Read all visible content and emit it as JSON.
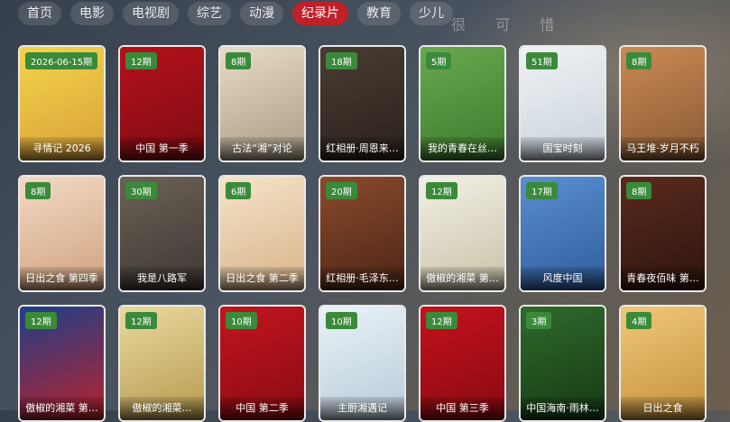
{
  "background_text": "很 可 惜",
  "tabs": [
    "首页",
    "电影",
    "电视剧",
    "综艺",
    "动漫",
    "纪录片",
    "教育",
    "少儿"
  ],
  "active_tab_index": 5,
  "accent_color": "#c0202a",
  "badge_color": "#3a8a3a",
  "cards": [
    {
      "badge": "2026-06-15期",
      "title": "寻情记 2026",
      "colors": [
        "#f4d44a",
        "#d8a13a"
      ]
    },
    {
      "badge": "12期",
      "title": "中国 第一季",
      "colors": [
        "#b5121b",
        "#7e0b12"
      ]
    },
    {
      "badge": "8期",
      "title": "古法“湘”对论",
      "colors": [
        "#e8dcc8",
        "#a99b84"
      ]
    },
    {
      "badge": "18期",
      "title": "红相册·周恩来…",
      "colors": [
        "#4a3c33",
        "#2b211c"
      ]
    },
    {
      "badge": "5期",
      "title": "我的青春在丝…",
      "colors": [
        "#6aa84f",
        "#3d7a2e"
      ]
    },
    {
      "badge": "51期",
      "title": "国宝时刻",
      "colors": [
        "#f0f2f4",
        "#c7d3dc"
      ]
    },
    {
      "badge": "8期",
      "title": "马王堆·岁月不朽",
      "colors": [
        "#c98a55",
        "#8a5a33"
      ]
    },
    {
      "badge": "8期",
      "title": "日出之食 第四季",
      "colors": [
        "#f3d9c4",
        "#cfa27e"
      ]
    },
    {
      "badge": "30期",
      "title": "我是八路军",
      "colors": [
        "#6b6157",
        "#3e3832"
      ]
    },
    {
      "badge": "6期",
      "title": "日出之食 第二季",
      "colors": [
        "#f5e3c8",
        "#d7b48a"
      ]
    },
    {
      "badge": "20期",
      "title": "红相册·毛泽东…",
      "colors": [
        "#8a4a2c",
        "#4d2617"
      ]
    },
    {
      "badge": "12期",
      "title": "傲椒的湘菜 第…",
      "colors": [
        "#f2efe4",
        "#c9c2a8"
      ]
    },
    {
      "badge": "17期",
      "title": "风度中国",
      "colors": [
        "#5a8fd0",
        "#2f5c9c"
      ]
    },
    {
      "badge": "8期",
      "title": "青春夜佰味 第…",
      "colors": [
        "#5a2b1e",
        "#2e140d"
      ]
    },
    {
      "badge": "12期",
      "title": "傲椒的湘菜 第…",
      "colors": [
        "#1f3f8a",
        "#b8222a"
      ]
    },
    {
      "badge": "12期",
      "title": "傲椒的湘菜…",
      "colors": [
        "#e9d9a0",
        "#b79a4e"
      ]
    },
    {
      "badge": "10期",
      "title": "中国 第二季",
      "colors": [
        "#c2151f",
        "#8a0b13"
      ]
    },
    {
      "badge": "10期",
      "title": "主厨湘遇记",
      "colors": [
        "#eaf2f7",
        "#b7cbd8"
      ]
    },
    {
      "badge": "12期",
      "title": "中国 第三季",
      "colors": [
        "#c5121c",
        "#880a11"
      ]
    },
    {
      "badge": "3期",
      "title": "中国海南·雨林…",
      "colors": [
        "#2f6a2c",
        "#163a14"
      ]
    },
    {
      "badge": "4期",
      "title": "日出之食",
      "colors": [
        "#f0c878",
        "#c4913c"
      ]
    }
  ]
}
